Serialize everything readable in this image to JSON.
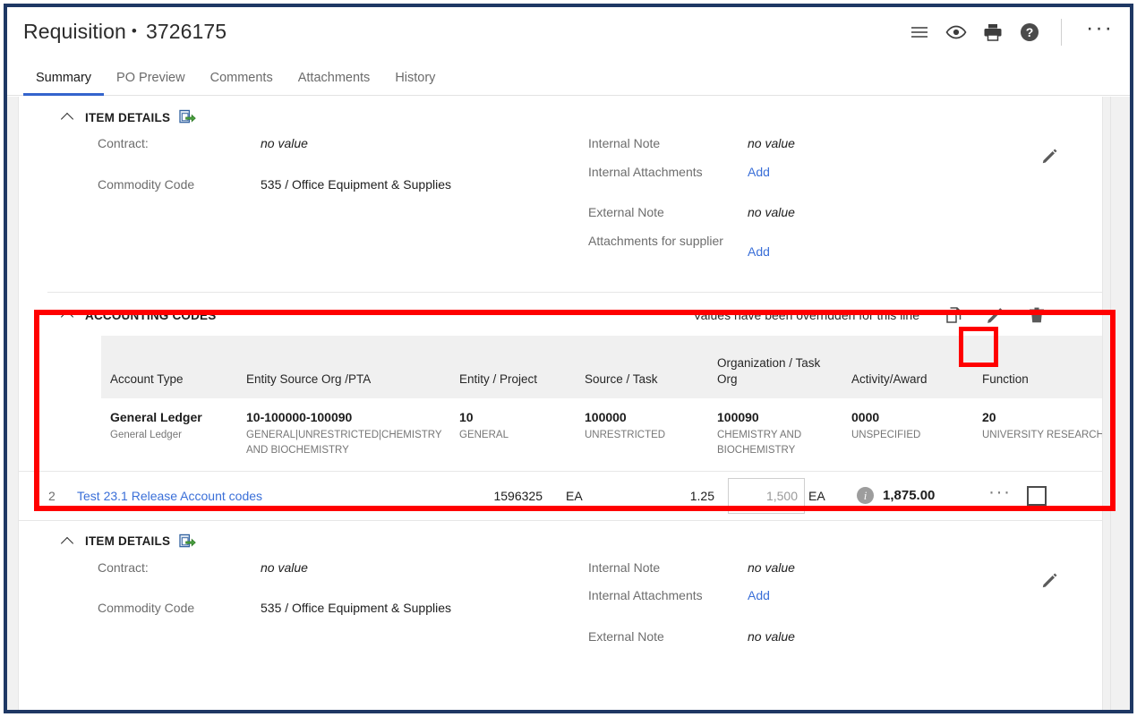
{
  "header": {
    "title": "Requisition",
    "separator": "•",
    "number": "3726175",
    "icons": [
      "menu-icon",
      "eye-icon",
      "printer-icon",
      "help-icon"
    ],
    "ellipsis": "···"
  },
  "tabs": [
    {
      "label": "Summary",
      "active": true
    },
    {
      "label": "PO Preview",
      "active": false
    },
    {
      "label": "Comments",
      "active": false
    },
    {
      "label": "Attachments",
      "active": false
    },
    {
      "label": "History",
      "active": false
    }
  ],
  "item_details_1": {
    "section_title": "ITEM DETAILS",
    "left_fields": [
      {
        "label": "Contract:",
        "value": "no value",
        "italic": true
      },
      {
        "label": "Commodity Code",
        "value": "535 / Office Equipment & Supplies",
        "italic": false
      }
    ],
    "right_fields": [
      {
        "label": "Internal Note",
        "value": "no value",
        "italic": true,
        "link": false
      },
      {
        "label": "Internal Attachments",
        "value": "Add",
        "italic": false,
        "link": true
      },
      {
        "label": "External Note",
        "value": "no value",
        "italic": true,
        "link": false
      },
      {
        "label": "Attachments for supplier",
        "value": "Add",
        "italic": false,
        "link": true
      }
    ]
  },
  "accounting_codes": {
    "section_title": "ACCOUNTING CODES",
    "override_message": "Values have been overridden for this line",
    "actions": [
      "copy-icon",
      "edit-pencil-icon",
      "trash-icon"
    ],
    "columns": [
      "Account Type",
      "Entity Source Org /PTA",
      "Entity / Project",
      "Source / Task",
      "Organization / Task Org",
      "Activity/Award",
      "Function"
    ],
    "rows": [
      [
        {
          "main": "General Ledger",
          "sub": "General Ledger"
        },
        {
          "main": "10-100000-100090",
          "sub": "GENERAL|UNRESTRICTED|CHEMISTRY AND BIOCHEMISTRY"
        },
        {
          "main": "10",
          "sub": "GENERAL"
        },
        {
          "main": "100000",
          "sub": "UNRESTRICTED"
        },
        {
          "main": "100090",
          "sub": "CHEMISTRY AND BIOCHEMISTRY"
        },
        {
          "main": "0000",
          "sub": "UNSPECIFIED"
        },
        {
          "main": "20",
          "sub": "UNIVERSITY RESEARCH"
        }
      ]
    ]
  },
  "line_item": {
    "number": "2",
    "name": "Test 23.1 Release Account codes",
    "catalog_number": "1596325",
    "unit_of_measure": "EA",
    "unit_price": "1.25",
    "quantity": "1,500",
    "quantity_uom": "EA",
    "info_icon": "i",
    "extended_price": "1,875.00",
    "row_menu": "···"
  },
  "item_details_2": {
    "section_title": "ITEM DETAILS",
    "left_fields": [
      {
        "label": "Contract:",
        "value": "no value",
        "italic": true
      },
      {
        "label": "Commodity Code",
        "value": "535 / Office Equipment & Supplies",
        "italic": false
      }
    ],
    "right_fields": [
      {
        "label": "Internal Note",
        "value": "no value",
        "italic": true,
        "link": false
      },
      {
        "label": "Internal Attachments",
        "value": "Add",
        "italic": false,
        "link": true
      },
      {
        "label": "External Note",
        "value": "no value",
        "italic": true,
        "link": false
      }
    ]
  },
  "colors": {
    "frame_border": "#1f3864",
    "highlight": "#ff0000",
    "tab_active_underline": "#3464cd",
    "link": "#3a6fd8",
    "table_header_bg": "#f0f0f0"
  }
}
